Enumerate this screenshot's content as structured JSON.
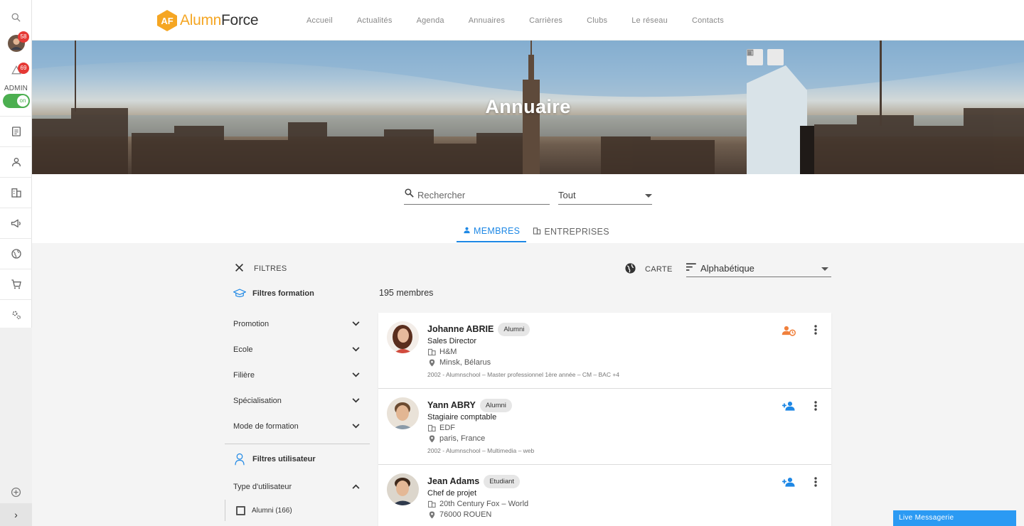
{
  "rail": {
    "badge_messages": "58",
    "badge_notifications": "69",
    "admin_label": "ADMIN",
    "toggle_label": "on",
    "menu_icons": [
      "document-icon",
      "person-icon",
      "building-icon",
      "megaphone-icon",
      "globe-icon",
      "cart-icon",
      "settings-icon"
    ]
  },
  "header": {
    "logo_part1": "Alumn",
    "logo_part2": "Force",
    "nav": [
      "Accueil",
      "Actualités",
      "Agenda",
      "Annuaires",
      "Carrières",
      "Clubs",
      "Le réseau",
      "Contacts"
    ]
  },
  "hero": {
    "title": "Annuaire"
  },
  "search": {
    "placeholder": "Rechercher",
    "filter_value": "Tout"
  },
  "tabs": [
    {
      "label": "MEMBRES"
    },
    {
      "label": "ENTREPRISES"
    }
  ],
  "toolbar": {
    "filters_label": "FILTRES",
    "map_label": "CARTE",
    "sort_value": "Alphabétique"
  },
  "sidebar": {
    "section_formation": "Filtres formation",
    "formation_filters": [
      "Promotion",
      "Ecole",
      "Filière",
      "Spécialisation",
      "Mode de formation"
    ],
    "section_user": "Filtres utilisateur",
    "user_type_label": "Type d'utilisateur",
    "user_type_options": [
      "Alumni (166)"
    ]
  },
  "results": {
    "count": "195 membres",
    "members": [
      {
        "name": "Johanne ABRIE",
        "tag": "Alumni",
        "job": "Sales Director",
        "company": "H&M",
        "location": "Minsk, Bélarus",
        "education": "2002 - Alumnschool – Master professionnel 1ère année – CM – BAC +4",
        "action_icon": "person-pending-icon"
      },
      {
        "name": "Yann ABRY",
        "tag": "Alumni",
        "job": "Stagiaire comptable",
        "company": "EDF",
        "location": "paris, France",
        "education": "2002 - Alumnschool – Multimedia – web",
        "action_icon": "person-add-icon"
      },
      {
        "name": "Jean Adams",
        "tag": "Etudiant",
        "job": "Chef de projet",
        "company": "20th Century Fox – World",
        "location": "76000 ROUEN",
        "education": "",
        "action_icon": "person-add-icon"
      }
    ]
  },
  "chat": {
    "label": "Live Messagerie"
  },
  "colors": {
    "brand_orange": "#f5a623",
    "accent_blue": "#1e88e5",
    "toggle_green": "#4caf50",
    "badge_red": "#e53935"
  }
}
